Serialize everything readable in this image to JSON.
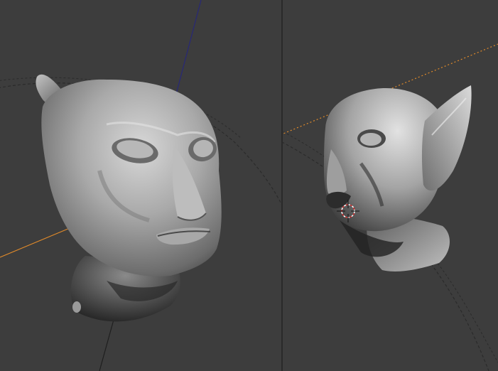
{
  "colors": {
    "background": "#3d3d3d",
    "divider": "#2a2a2a",
    "axis_x": "#e08a2a",
    "axis_z": "#28287a",
    "dashed_ring": "#2c2c2c",
    "mesh_light": "#bdbdbd",
    "mesh_mid": "#8a8a8a",
    "mesh_shadow": "#1e1e1e",
    "cursor_ring": "#ffffff",
    "cursor_red": "#d03030"
  },
  "viewports": [
    {
      "id": "left",
      "view": "front-perspective",
      "content": "sculpted-head-mesh"
    },
    {
      "id": "right",
      "view": "side-perspective",
      "content": "sculpted-head-mesh"
    }
  ],
  "icons": {
    "cursor": "3d-cursor-icon"
  }
}
